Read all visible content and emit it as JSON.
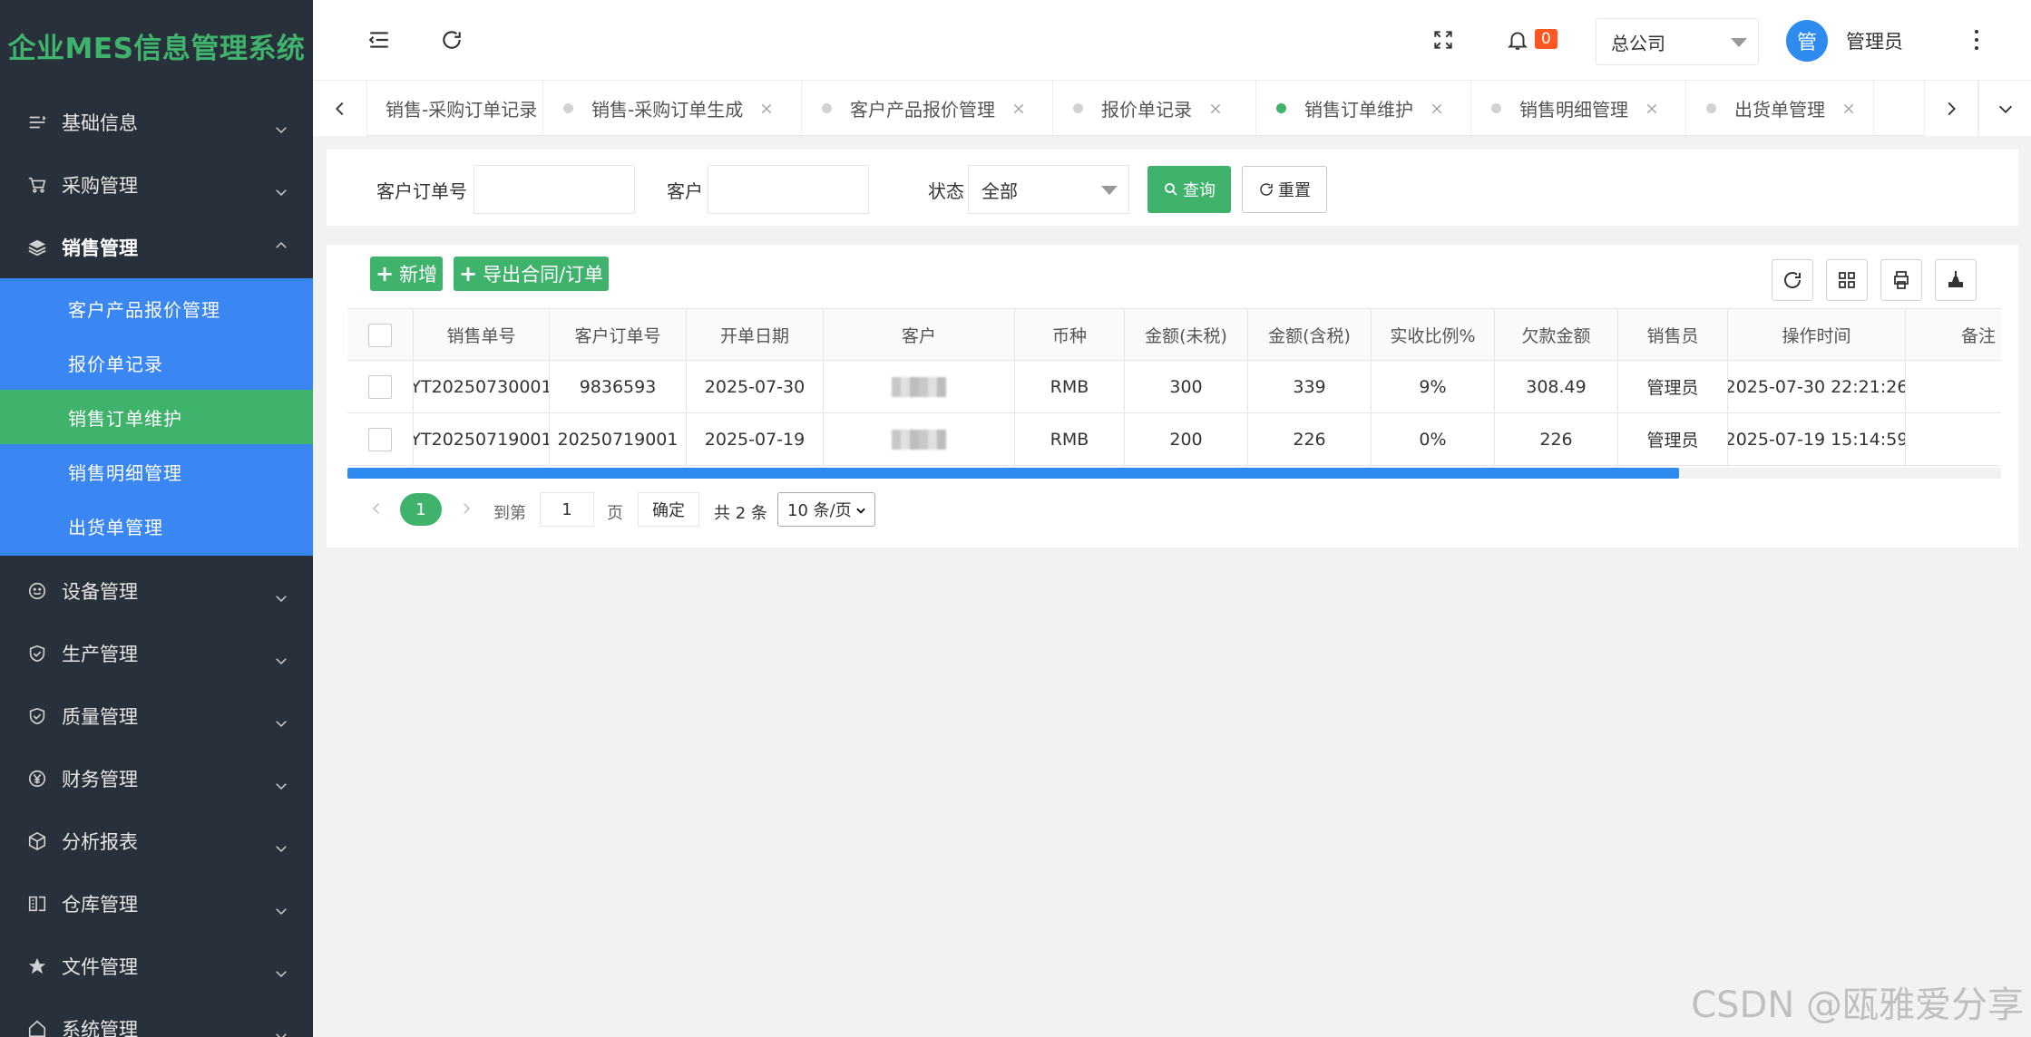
{
  "app": {
    "title": "企业MES信息管理系统"
  },
  "sidebar": {
    "menus": [
      {
        "label": "基础信息",
        "icon": "list-icon"
      },
      {
        "label": "采购管理",
        "icon": "cart-icon"
      },
      {
        "label": "销售管理",
        "icon": "layers-icon",
        "expanded": true
      }
    ],
    "sales_submenu": [
      {
        "label": "客户产品报价管理"
      },
      {
        "label": "报价单记录"
      },
      {
        "label": "销售订单维护",
        "active": true
      },
      {
        "label": "销售明细管理"
      },
      {
        "label": "出货单管理"
      }
    ],
    "menus_after": [
      {
        "label": "设备管理",
        "icon": "smile-icon"
      },
      {
        "label": "生产管理",
        "icon": "shield-icon"
      },
      {
        "label": "质量管理",
        "icon": "shield-check-icon"
      },
      {
        "label": "财务管理",
        "icon": "yen-icon"
      },
      {
        "label": "分析报表",
        "icon": "cube-icon"
      },
      {
        "label": "仓库管理",
        "icon": "warehouse-icon"
      },
      {
        "label": "文件管理",
        "icon": "star-icon"
      },
      {
        "label": "系统管理",
        "icon": "home-icon"
      }
    ]
  },
  "header": {
    "notification_count": "0",
    "company": "总公司",
    "avatar_text": "管",
    "username": "管理员"
  },
  "tabs": [
    {
      "label": "销售-采购订单记录",
      "dot": false
    },
    {
      "label": "销售-采购订单生成",
      "dot": true
    },
    {
      "label": "客户产品报价管理",
      "dot": true
    },
    {
      "label": "报价单记录",
      "dot": true
    },
    {
      "label": "销售订单维护",
      "dot": true,
      "active": true
    },
    {
      "label": "销售明细管理",
      "dot": true
    },
    {
      "label": "出货单管理",
      "dot": true
    }
  ],
  "search": {
    "customer_order_label": "客户订单号",
    "customer_order_value": "",
    "customer_label": "客户",
    "customer_value": "",
    "status_label": "状态",
    "status_value": "全部",
    "query_label": "查询",
    "reset_label": "重置"
  },
  "toolbar": {
    "add_label": "新增",
    "export_label": "导出合同/订单"
  },
  "table": {
    "columns": [
      "销售单号",
      "客户订单号",
      "开单日期",
      "客户",
      "币种",
      "金额(未税)",
      "金额(含税)",
      "实收比例%",
      "欠款金额",
      "销售员",
      "操作时间",
      "备注"
    ],
    "rows": [
      {
        "sales_no": "YT20250730001",
        "customer_order": "9836593",
        "date": "2025-07-30",
        "customer": "",
        "currency": "RMB",
        "amount_ex_tax": "300",
        "amount_inc_tax": "339",
        "received_pct": "9%",
        "debt": "308.49",
        "salesperson": "管理员",
        "op_time": "2025-07-30 22:21:26",
        "remark": ""
      },
      {
        "sales_no": "YT20250719001",
        "customer_order": "20250719001",
        "date": "2025-07-19",
        "customer": "",
        "currency": "RMB",
        "amount_ex_tax": "200",
        "amount_inc_tax": "226",
        "received_pct": "0%",
        "debt": "226",
        "salesperson": "管理员",
        "op_time": "2025-07-19 15:14:59",
        "remark": ""
      }
    ]
  },
  "pagination": {
    "current_page": "1",
    "goto_label": "到第",
    "goto_value": "1",
    "page_unit": "页",
    "confirm_label": "确定",
    "total_text": "共 2 条",
    "page_size": "10 条/页"
  },
  "watermark": "CSDN @瓯雅爱分享",
  "colors": {
    "sidebar_bg": "#28313b",
    "accent_green": "#3fb26c",
    "accent_blue": "#3a86f3",
    "badge_orange": "#ff5722"
  }
}
